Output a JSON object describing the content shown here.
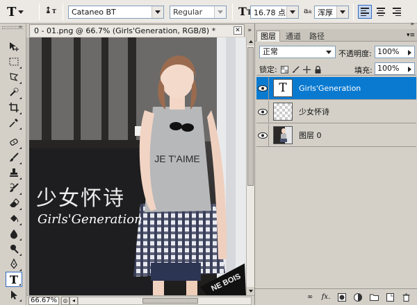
{
  "options_bar": {
    "font_family": "Cataneo BT",
    "font_style": "Regular",
    "font_size": "16.78 点",
    "antialias": "浑厚",
    "align_buttons": [
      "align-left",
      "align-center",
      "align-right"
    ],
    "active_align": "align-left"
  },
  "toolbox": {
    "tools": [
      "move",
      "marquee",
      "lasso",
      "quick-selection",
      "crop",
      "eyedropper",
      "healing-brush",
      "brush",
      "clone-stamp",
      "history-brush",
      "eraser",
      "paint-bucket",
      "blur",
      "dodge",
      "pen",
      "type",
      "path-selection"
    ],
    "active_tool": "type"
  },
  "document": {
    "tab_title": "0 - 01.png @ 66.7% (Girls'Generation, RGB/8) *",
    "zoom": "66.67%",
    "canvas_overlay": {
      "chinese_title": "少女怀诗",
      "english_title": "Girls'Generation",
      "shirt_text": "JE T'AIME",
      "box_text": "NE BOIS"
    }
  },
  "layers_panel": {
    "tabs": [
      "图层",
      "通道",
      "路径"
    ],
    "active_tab": "图层",
    "blend_mode": "正常",
    "opacity_label": "不透明度:",
    "opacity_value": "100%",
    "lock_label": "锁定:",
    "fill_label": "填充:",
    "fill_value": "100%",
    "layers": [
      {
        "name": "Girls'Generation",
        "type": "text",
        "selected": true
      },
      {
        "name": "少女怀诗",
        "type": "transparent",
        "selected": false
      },
      {
        "name": "图层 0",
        "type": "image",
        "selected": false
      }
    ],
    "footer_icons": [
      "link-icon",
      "fx-icon",
      "mask-icon",
      "adjustment-icon",
      "group-folder-icon",
      "new-layer-icon",
      "trash-icon"
    ]
  },
  "colors": {
    "selection_blue": "#0a7ad1",
    "panel_bg": "#d4d0c8",
    "active_align_bg": "#c6d6ef"
  }
}
